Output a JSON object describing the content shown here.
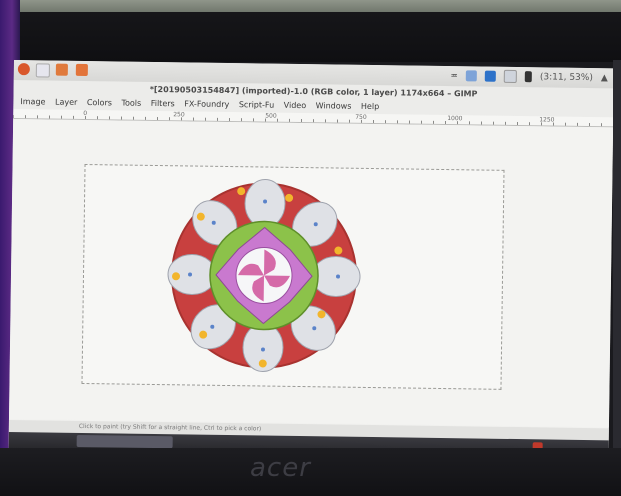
{
  "topbar": {
    "clock": "(3:11, 53%)",
    "sound_icon": "speaker-icon"
  },
  "window": {
    "title": "*[20190503154847] (imported)-1.0 (RGB color, 1 layer) 1174x664 – GIMP"
  },
  "menu": {
    "items": [
      "Image",
      "Layer",
      "Colors",
      "Tools",
      "Filters",
      "FX-Foundry",
      "Script-Fu",
      "Video",
      "Windows",
      "Help"
    ]
  },
  "ruler": {
    "ticks": [
      "0",
      "250",
      "500",
      "750",
      "1000",
      "1250"
    ]
  },
  "statusbar": {
    "text": "Click to paint (try Shift for a straight line, Ctrl to pick a color)"
  },
  "colors": {
    "ring_red": "#c8403f",
    "petal": "#dfe1e6",
    "leaf_green": "#8cc24a",
    "pink": "#c979cf",
    "star_yellow": "#f2b52c"
  },
  "brand": "acer"
}
